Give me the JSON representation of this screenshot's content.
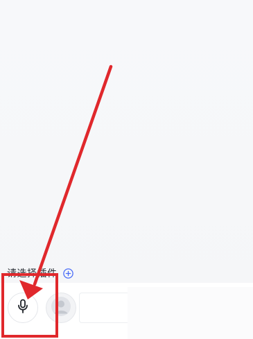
{
  "plugin": {
    "label": "请选择插件",
    "add_icon": "plus-circle-icon"
  },
  "voice_button": {
    "icon": "microphone-icon"
  },
  "avatar_button": {
    "icon": "user-avatar-icon"
  },
  "annotation": {
    "color": "#e0282c",
    "arrow_icon": "red-arrow",
    "box": "red-highlight-box"
  },
  "colors": {
    "background": "#f6f7f9",
    "accent_blue": "#4a6cf7",
    "text": "#2b2f36"
  }
}
